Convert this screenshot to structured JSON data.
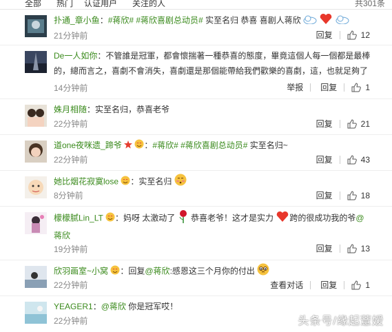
{
  "tabs": {
    "all": "全部",
    "hot": "热门",
    "verified": "认证用户",
    "following": "关注的人",
    "total": "共301条"
  },
  "comments": [
    {
      "user": "扑通_章小鱼",
      "tag": "#蒋欣# #蒋欣喜剧总动员#",
      "text": " 实至名归 恭喜 喜剧人蒋欣",
      "time": "21分钟前",
      "reply": "回复",
      "likes": "12"
    },
    {
      "user": "De一人如你",
      "text_line1": "：不管誰是冠軍，都會懷揣著一種恭喜的態度，畢竟這個人每一個都是最棒",
      "text_line2": "的，總而言之，喜劇不會消失，喜劇還是那個能帶給我們歡樂的喜劇，這，也就足夠了",
      "time": "14分钟前",
      "report": "举报",
      "reply": "回复",
      "likes": "1"
    },
    {
      "user": "姝月相随",
      "text": "：实至名归，恭喜老爷",
      "time": "22分钟前",
      "reply": "回复",
      "likes": "21"
    },
    {
      "user": "道one夜咪遗_蹄爷",
      "tag": "#蒋欣# #蒋欣喜剧总动员#",
      "text": " 实至名归~",
      "time": "22分钟前",
      "reply": "回复",
      "likes": "43"
    },
    {
      "user": "她比烟花寂寞lose",
      "text": "：实至名归",
      "time": "8分钟前",
      "reply": "回复",
      "likes": "18"
    },
    {
      "user": "檬檬腻Lin_LT",
      "text_a": "：妈呀 太激动了",
      "text_b": " 恭喜老爷！这才是实力",
      "text_c": "跨的很成功我的爷",
      "mention": "@",
      "mention2": "蒋欣",
      "time": "19分钟前",
      "reply": "回复",
      "likes": "13"
    },
    {
      "user": "欣羽画室~小窝",
      "text_a": "：回复",
      "mention": "@蒋欣",
      "text_b": ":感恩这三个月你的付出",
      "time": "22分钟前",
      "view_convo": "查看对话",
      "reply": "回复",
      "likes": "1"
    },
    {
      "user": "YEAGER1",
      "text_a": "：",
      "mention": "@蒋欣",
      "text_b": " 你是冠军哎！",
      "time": "22分钟前"
    }
  ],
  "watermark": "头条号/缘起薏嫒",
  "colors": {
    "username": "#3a8a1c",
    "time": "#888888",
    "heart": "#e8372b"
  }
}
